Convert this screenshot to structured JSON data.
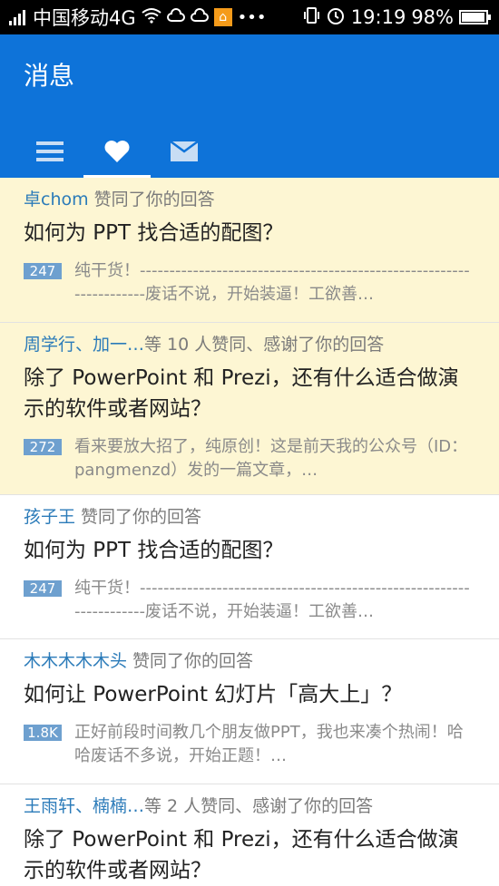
{
  "status_bar": {
    "carrier": "中国移动4G",
    "dots": "•••",
    "time": "19:19",
    "battery": "98%",
    "battery_level": 0.98,
    "icons": [
      "signal-icon",
      "wifi-icon",
      "cloud-icon",
      "cloud-icon",
      "home-app-icon",
      "vibrate-icon",
      "alarm-icon",
      "battery-icon"
    ]
  },
  "header": {
    "title": "消息",
    "background_color": "#0e73d9",
    "tabs": [
      {
        "icon": "menu-icon",
        "active": false
      },
      {
        "icon": "heart-icon",
        "active": true
      },
      {
        "icon": "mail-icon",
        "active": false
      }
    ]
  },
  "notifications": [
    {
      "actor": "卓chom",
      "action": " 赞同了你的回答",
      "question": "如何为 PPT 找合适的配图？",
      "votes": "247",
      "excerpt": "纯干货！--------------------------------------------------------------------废话不说，开始装逼！工欲善…",
      "unread": true
    },
    {
      "actor": "周学行、加一…",
      "action": "等 10 人赞同、感谢了你的回答",
      "question": "除了 PowerPoint 和 Prezi，还有什么适合做演示的软件或者网站？",
      "votes": "272",
      "excerpt": "看来要放大招了，纯原创！这是前天我的公众号（ID：pangmenzd）发的一篇文章，…",
      "unread": true
    },
    {
      "actor": "孩子王",
      "action": " 赞同了你的回答",
      "question": "如何为 PPT 找合适的配图？",
      "votes": "247",
      "excerpt": "纯干货！--------------------------------------------------------------------废话不说，开始装逼！工欲善…",
      "unread": false
    },
    {
      "actor": "木木木木木头",
      "action": " 赞同了你的回答",
      "question": "如何让 PowerPoint 幻灯片「高大上」？",
      "votes": "1.8K",
      "excerpt": "正好前段时间教几个朋友做PPT，我也来凑个热闹！哈哈废话不多说，开始正题！…",
      "unread": false
    },
    {
      "actor": "王雨轩、楠楠…",
      "action": "等 2 人赞同、感谢了你的回答",
      "question": "除了 PowerPoint 和 Prezi，还有什么适合做演示的软件或者网站？",
      "votes": "",
      "excerpt": "",
      "unread": false
    }
  ]
}
